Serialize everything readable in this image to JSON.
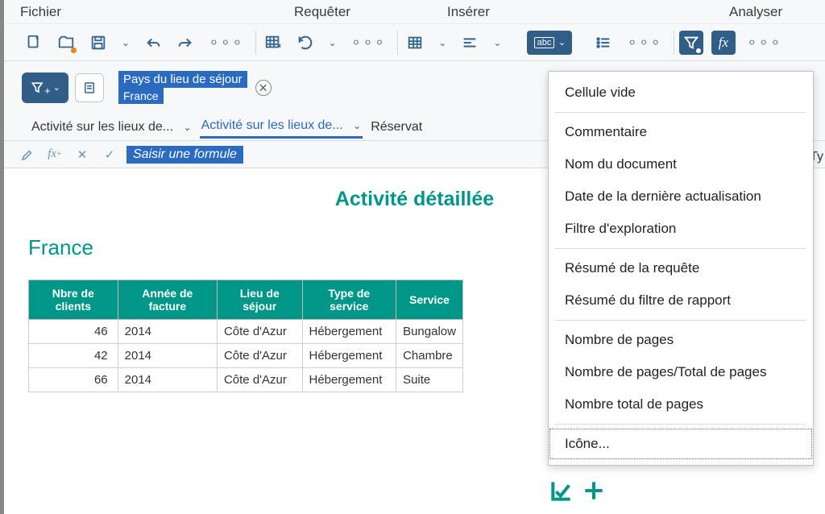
{
  "menubar": {
    "file": "Fichier",
    "query": "Requêter",
    "insert": "Insérer",
    "analyze": "Analyser"
  },
  "filter": {
    "chip_label": "Pays du lieu de séjour",
    "chip_value": "France"
  },
  "tabs": {
    "t1": "Activité sur les lieux de...",
    "t2": "Activité sur les lieux de...",
    "t3": "Réservat"
  },
  "formula": {
    "placeholder": "Saisir une formule"
  },
  "right_clip": "Ty",
  "report": {
    "title": "Activité détaillée",
    "section": "France",
    "headers": {
      "c1": "Nbre de clients",
      "c2": "Année de facture",
      "c3": "Lieu de séjour",
      "c4": "Type de service",
      "c5": "Service"
    },
    "rows": [
      {
        "c1": "46",
        "c2": "2014",
        "c3": "Côte d'Azur",
        "c4": "Hébergement",
        "c5": "Bungalow"
      },
      {
        "c1": "42",
        "c2": "2014",
        "c3": "Côte d'Azur",
        "c4": "Hébergement",
        "c5": "Chambre"
      },
      {
        "c1": "66",
        "c2": "2014",
        "c3": "Côte d'Azur",
        "c4": "Hébergement",
        "c5": "Suite"
      }
    ]
  },
  "dropdown": {
    "i1": "Cellule vide",
    "i2": "Commentaire",
    "i3": "Nom du document",
    "i4": "Date de la dernière actualisation",
    "i5": "Filtre d'exploration",
    "i6": "Résumé de la requête",
    "i7": "Résumé du filtre de rapport",
    "i8": "Nombre de pages",
    "i9": "Nombre de pages/Total de pages",
    "i10": "Nombre total de pages",
    "i11": "Icône..."
  }
}
